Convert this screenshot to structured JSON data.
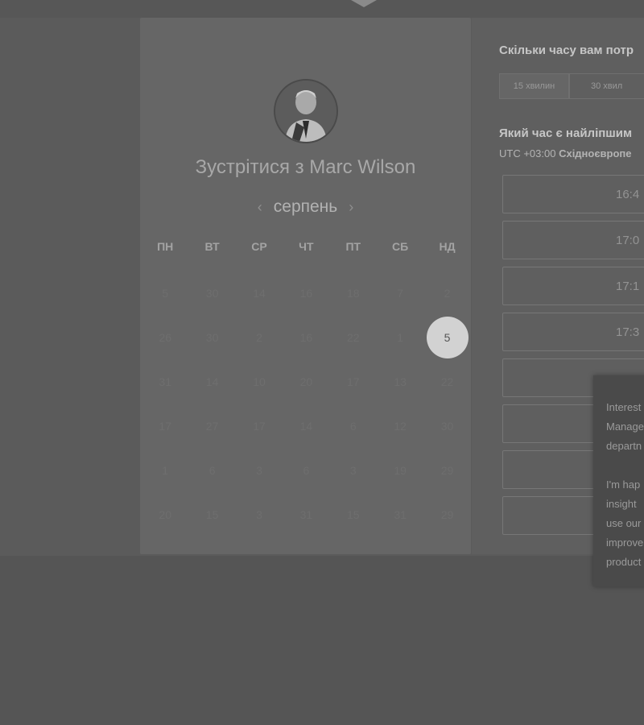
{
  "calendar": {
    "heading": "Зустрітися з Marc Wilson",
    "month": "серпень",
    "prev_icon": "‹",
    "next_icon": "›",
    "weekdays": [
      "ПН",
      "ВТ",
      "СР",
      "ЧТ",
      "ПТ",
      "СБ",
      "НД"
    ],
    "weeks": [
      [
        "5",
        "30",
        "14",
        "16",
        "18",
        "7",
        "2"
      ],
      [
        "26",
        "30",
        "2",
        "16",
        "22",
        "1",
        "5"
      ],
      [
        "31",
        "14",
        "10",
        "20",
        "17",
        "13",
        "22"
      ],
      [
        "17",
        "27",
        "17",
        "14",
        "6",
        "12",
        "30"
      ],
      [
        "1",
        "6",
        "3",
        "6",
        "3",
        "19",
        "29"
      ],
      [
        "20",
        "15",
        "3",
        "31",
        "15",
        "31",
        "29"
      ]
    ],
    "selected_day": "5"
  },
  "booking": {
    "duration_question": "Скільки часу вам потр",
    "durations": [
      "15 хвилин",
      "30 хвил"
    ],
    "time_question": "Який час є найліпшим",
    "timezone_offset": "UTC +03:00",
    "timezone_name": "Східноєвропе",
    "slots": [
      "16:4",
      "17:0",
      "17:1",
      "17:3",
      "",
      "",
      "",
      ""
    ]
  },
  "popup": {
    "lines": [
      "Interest",
      "Manage",
      "departn",
      "",
      "I'm hap",
      "insight",
      "use our",
      "improve",
      "product"
    ]
  }
}
